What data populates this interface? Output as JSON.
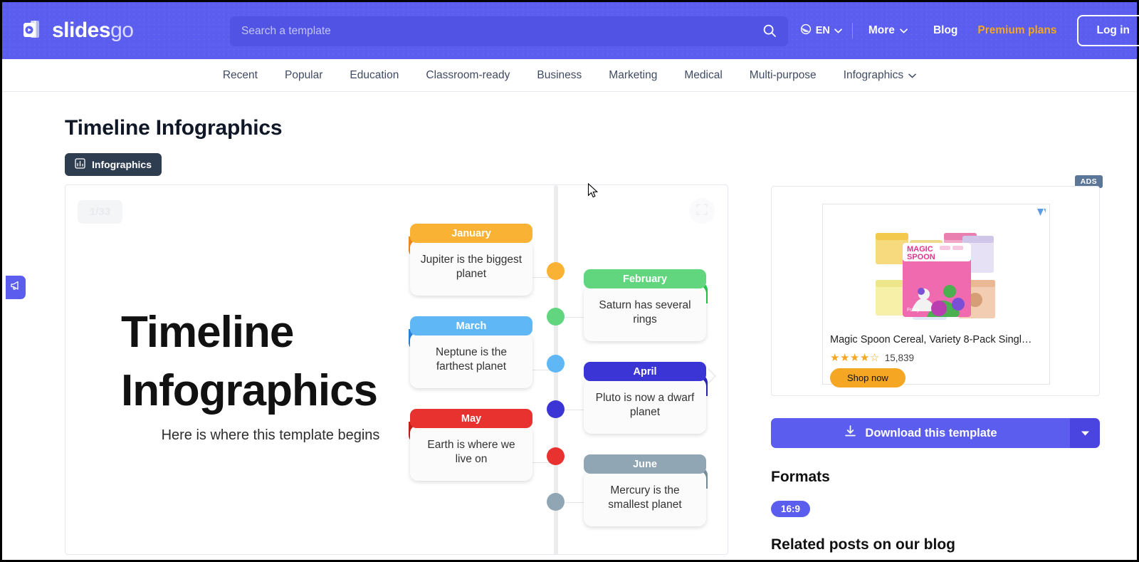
{
  "header": {
    "logo_text": "slides",
    "logo_text_accent": "go",
    "logo_icon": "slidesgo-logo-icon",
    "search": {
      "placeholder": "Search a template",
      "value": "",
      "icon": "search-icon"
    },
    "language": {
      "label": "EN",
      "icon": "globe-icon",
      "caret": "chevron-down-icon"
    },
    "more": {
      "label": "More",
      "caret": "chevron-down-icon"
    },
    "blog": "Blog",
    "premium": "Premium plans",
    "login": "Log in",
    "bg_color": "#5a5ded",
    "premium_color": "#f5a623"
  },
  "nav": {
    "items": [
      {
        "label": "Recent",
        "caret": false
      },
      {
        "label": "Popular",
        "caret": false
      },
      {
        "label": "Education",
        "caret": false
      },
      {
        "label": "Classroom-ready",
        "caret": false
      },
      {
        "label": "Business",
        "caret": false
      },
      {
        "label": "Marketing",
        "caret": false
      },
      {
        "label": "Medical",
        "caret": false
      },
      {
        "label": "Multi-purpose",
        "caret": false
      },
      {
        "label": "Infographics",
        "caret": true
      }
    ]
  },
  "page": {
    "title": "Timeline Infographics",
    "category_badge": {
      "label": "Infographics",
      "icon": "bar-chart-icon"
    }
  },
  "viewer": {
    "counter": "1/33",
    "fullscreen_icon": "fullscreen-icon",
    "next_icon": "chevron-right-icon"
  },
  "slide": {
    "title": "Timeline Infographics",
    "subtitle": "Here is where this template begins",
    "timeline": [
      {
        "month": "January",
        "text": "Jupiter is the biggest planet",
        "color": "#f9b233",
        "dark": "#ec8b1b",
        "side": "left"
      },
      {
        "month": "February",
        "text": "Saturn has several rings",
        "color": "#61d67f",
        "dark": "#27c64a",
        "side": "right"
      },
      {
        "month": "March",
        "text": "Neptune is the farthest planet",
        "color": "#5fb8f5",
        "dark": "#2a7fd4",
        "side": "left"
      },
      {
        "month": "April",
        "text": "Pluto is now a dwarf planet",
        "color": "#3a35d4",
        "dark": "#2a24b8",
        "side": "right"
      },
      {
        "month": "May",
        "text": "Earth is where we live on",
        "color": "#e8322f",
        "dark": "#c41e1b",
        "side": "left"
      },
      {
        "month": "June",
        "text": "Mercury is the smallest planet",
        "color": "#90a6b5",
        "dark": "#7a8f9e",
        "side": "right"
      }
    ]
  },
  "ad": {
    "badge": "ADS",
    "choices_icon": "ad-choices-icon",
    "image_alt": "magic-spoon-cereal-boxes",
    "title": "Magic Spoon Cereal, Variety 8-Pack Singl…",
    "stars": "★★★★☆",
    "rating_count": "15,839",
    "cta": "Shop now",
    "cta_color": "#f5a623"
  },
  "sidebar": {
    "download_label": "Download this template",
    "download_icon": "download-icon",
    "download_caret": "chevron-down-icon",
    "formats_title": "Formats",
    "formats": [
      "16:9"
    ],
    "related_title": "Related posts on our blog"
  },
  "feedback": {
    "icon": "megaphone-icon"
  }
}
